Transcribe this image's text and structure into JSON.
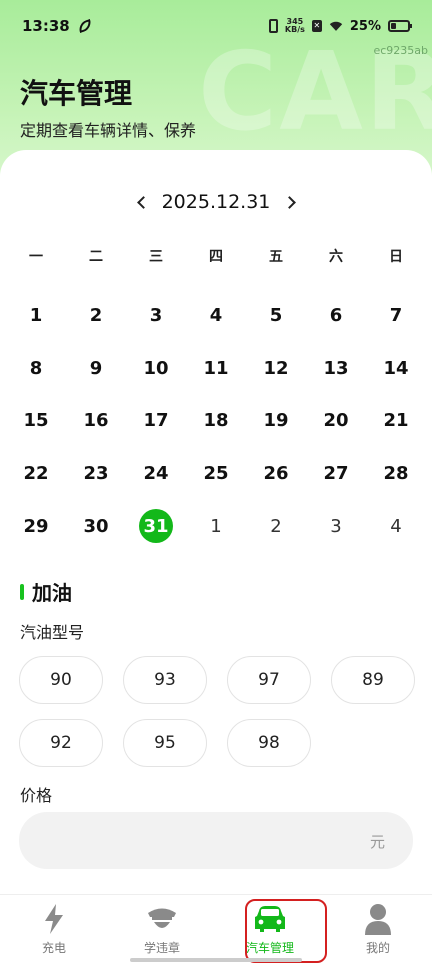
{
  "status_bar": {
    "time": "13:38",
    "net_speed_value": "345",
    "net_speed_unit": "KB/s",
    "battery": "25%"
  },
  "header": {
    "title": "汽车管理",
    "subtitle": "定期查看车辆详情、保养",
    "watermark": "CAR",
    "watermark_id": "ec9235ab"
  },
  "calendar": {
    "month_label": "2025.12.31",
    "weekdays": [
      "一",
      "二",
      "三",
      "四",
      "五",
      "六",
      "日"
    ],
    "days": [
      {
        "label": "1",
        "current": true
      },
      {
        "label": "2",
        "current": true
      },
      {
        "label": "3",
        "current": true
      },
      {
        "label": "4",
        "current": true
      },
      {
        "label": "5",
        "current": true
      },
      {
        "label": "6",
        "current": true
      },
      {
        "label": "7",
        "current": true
      },
      {
        "label": "8",
        "current": true
      },
      {
        "label": "9",
        "current": true
      },
      {
        "label": "10",
        "current": true
      },
      {
        "label": "11",
        "current": true
      },
      {
        "label": "12",
        "current": true
      },
      {
        "label": "13",
        "current": true
      },
      {
        "label": "14",
        "current": true
      },
      {
        "label": "15",
        "current": true
      },
      {
        "label": "16",
        "current": true
      },
      {
        "label": "17",
        "current": true
      },
      {
        "label": "18",
        "current": true
      },
      {
        "label": "19",
        "current": true
      },
      {
        "label": "20",
        "current": true
      },
      {
        "label": "21",
        "current": true
      },
      {
        "label": "22",
        "current": true
      },
      {
        "label": "23",
        "current": true
      },
      {
        "label": "24",
        "current": true
      },
      {
        "label": "25",
        "current": true
      },
      {
        "label": "26",
        "current": true
      },
      {
        "label": "27",
        "current": true
      },
      {
        "label": "28",
        "current": true
      },
      {
        "label": "29",
        "current": true
      },
      {
        "label": "30",
        "current": true
      },
      {
        "label": "31",
        "current": true,
        "selected": true
      },
      {
        "label": "1",
        "current": false
      },
      {
        "label": "2",
        "current": false
      },
      {
        "label": "3",
        "current": false
      },
      {
        "label": "4",
        "current": false
      }
    ]
  },
  "fuel": {
    "section_title": "加油",
    "type_label": "汽油型号",
    "types": [
      "90",
      "93",
      "97",
      "89",
      "92",
      "95",
      "98"
    ],
    "price_label": "价格",
    "price_value": "",
    "price_unit": "元"
  },
  "colors": {
    "accent": "#13b81a",
    "highlight_box": "#d42020"
  },
  "tabbar": {
    "items": [
      {
        "label": "充电",
        "icon": "lightning-icon",
        "active": false
      },
      {
        "label": "学违章",
        "icon": "police-icon",
        "active": false
      },
      {
        "label": "汽车管理",
        "icon": "car-icon",
        "active": true
      },
      {
        "label": "我的",
        "icon": "person-icon",
        "active": false
      }
    ]
  }
}
